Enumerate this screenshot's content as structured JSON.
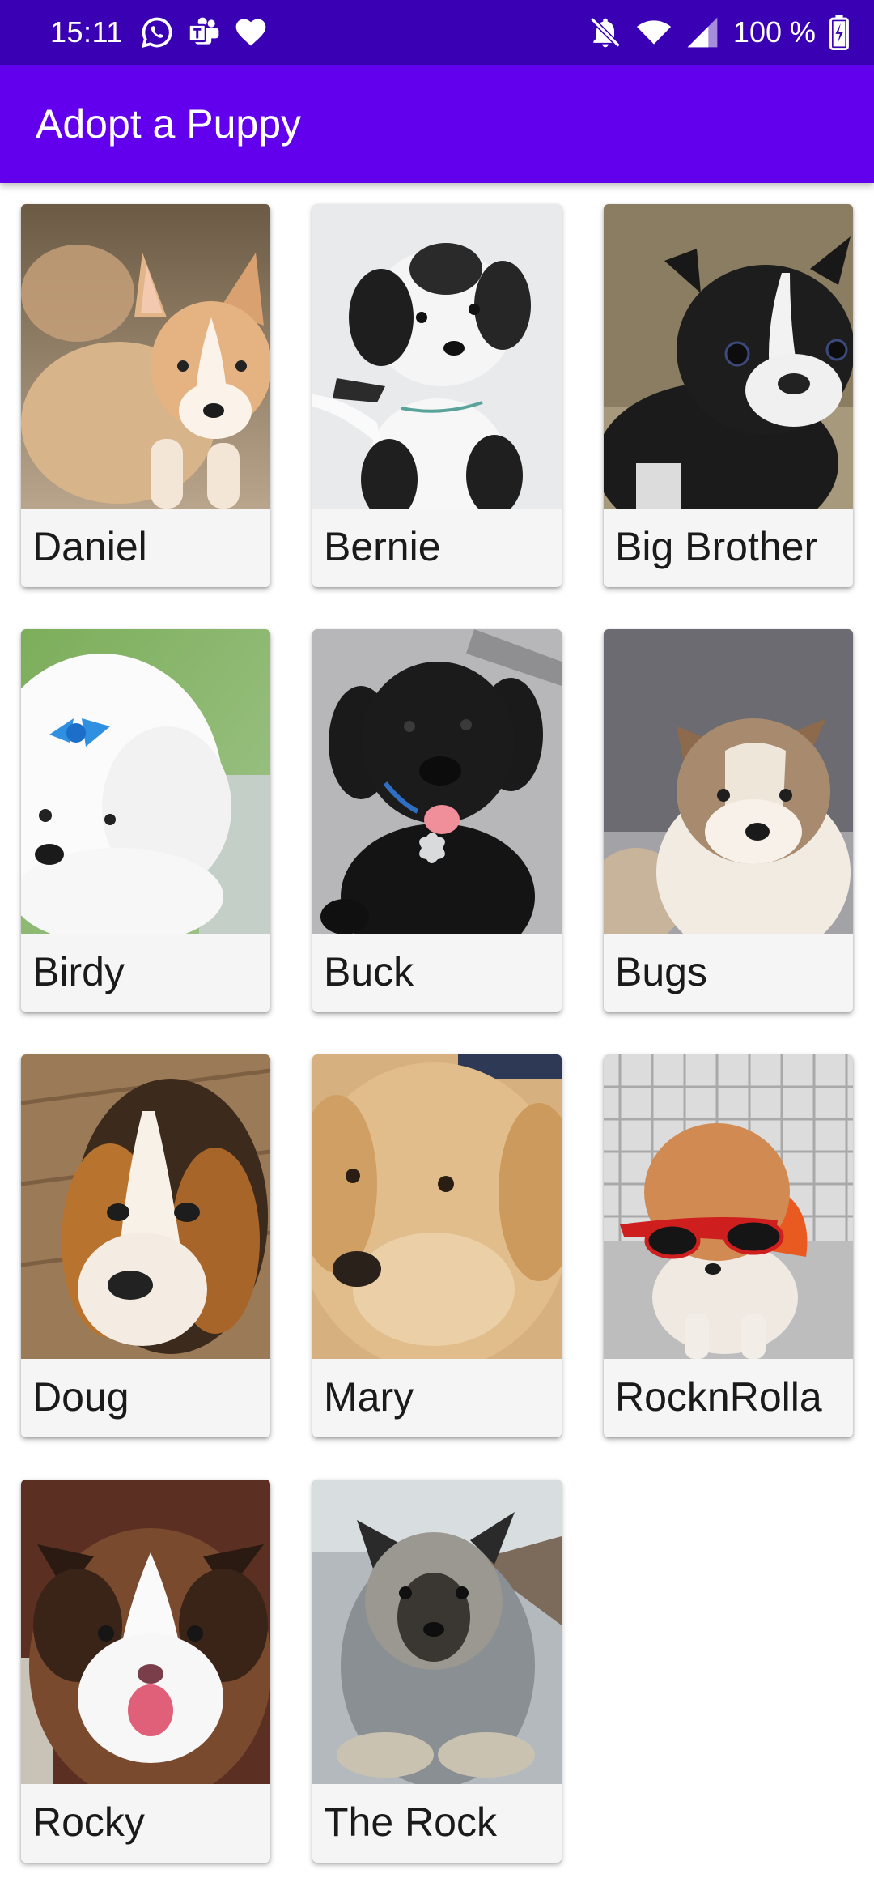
{
  "status_bar": {
    "time": "15:11",
    "left_icons": [
      "whatsapp-icon",
      "teams-icon",
      "heart-icon"
    ],
    "right_icons": [
      "bell-off-icon",
      "wifi-icon",
      "signal-icon"
    ],
    "battery_text": "100 %",
    "battery_icon": "battery-charging-icon"
  },
  "app_bar": {
    "title": "Adopt a Puppy",
    "color": "#6200ee"
  },
  "puppies": [
    {
      "name": "Daniel"
    },
    {
      "name": "Bernie"
    },
    {
      "name": "Big Brother"
    },
    {
      "name": "Birdy"
    },
    {
      "name": "Buck"
    },
    {
      "name": "Bugs"
    },
    {
      "name": "Doug"
    },
    {
      "name": "Mary"
    },
    {
      "name": "RocknRolla"
    },
    {
      "name": "Rocky"
    },
    {
      "name": "The Rock"
    }
  ]
}
